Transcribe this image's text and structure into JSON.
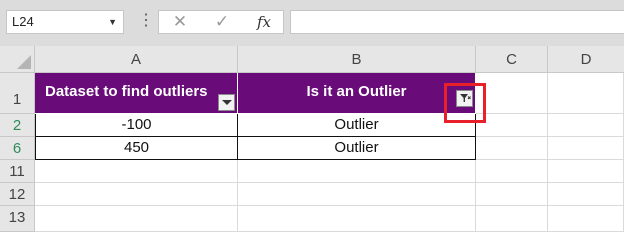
{
  "formula_bar": {
    "name_box": "L24",
    "more_glyph": "⋮",
    "cancel_glyph": "✕",
    "enter_glyph": "✓",
    "function_glyph": "fx",
    "formula": ""
  },
  "columns": [
    "A",
    "B",
    "C",
    "D"
  ],
  "rows": [
    {
      "number": "1",
      "filtered": false,
      "a": "Dataset to find outliers",
      "b": "Is it an Outlier"
    },
    {
      "number": "2",
      "filtered": true,
      "a": "-100",
      "b": "Outlier"
    },
    {
      "number": "6",
      "filtered": true,
      "a": "450",
      "b": "Outlier"
    },
    {
      "number": "11",
      "filtered": false,
      "a": "",
      "b": ""
    },
    {
      "number": "12",
      "filtered": false,
      "a": "",
      "b": ""
    },
    {
      "number": "13",
      "filtered": false,
      "a": "",
      "b": ""
    }
  ],
  "colors": {
    "header_fill": "#690c7a",
    "filtered_row_number": "#2e8b57",
    "highlight_box": "#e8202a"
  },
  "icons": {
    "column_a_filter": "dropdown-arrow-icon",
    "column_b_filter": "filter-applied-icon"
  }
}
